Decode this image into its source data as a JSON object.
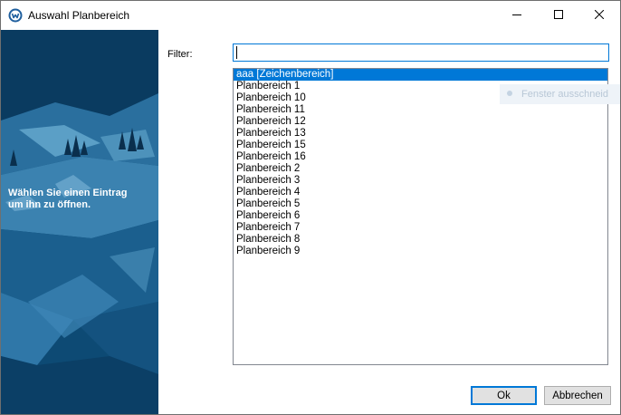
{
  "window": {
    "title": "Auswahl Planbereich",
    "app_icon": "app-logo-icon",
    "controls": [
      "minimize-icon",
      "maximize-icon",
      "close-icon"
    ]
  },
  "side_panel": {
    "line1": "Wählen Sie einen Eintrag",
    "line2": "um ihn zu öffnen."
  },
  "filter": {
    "label": "Filter:",
    "value": ""
  },
  "list": {
    "selected_index": 0,
    "items": [
      "aaa [Zeichenbereich]",
      "Planbereich 1",
      "Planbereich 10",
      "Planbereich 11",
      "Planbereich 12",
      "Planbereich 13",
      "Planbereich 15",
      "Planbereich 16",
      "Planbereich 2",
      "Planbereich 3",
      "Planbereich 4",
      "Planbereich 5",
      "Planbereich 6",
      "Planbereich 7",
      "Planbereich 8",
      "Planbereich 9"
    ]
  },
  "background_window": {
    "text": "Fenster ausschneid"
  },
  "buttons": {
    "ok": "Ok",
    "cancel": "Abbrechen"
  },
  "colors": {
    "selection": "#0078d7",
    "side_panel": "#0e4f7c",
    "button_face": "#e1e1e1"
  }
}
